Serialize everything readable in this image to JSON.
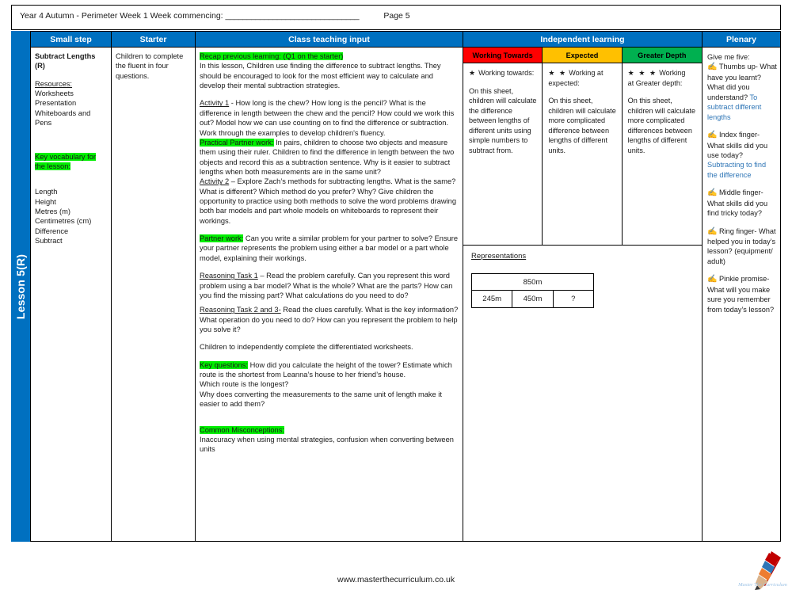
{
  "header": {
    "title": "Year 4 Autumn - Perimeter Week 1 Week commencing:",
    "blank_line": "_______________________________",
    "page_label": "Page 5"
  },
  "lesson_tab": {
    "label": "Lesson 5(R)"
  },
  "colors": {
    "header_blue": "#0070C0",
    "working_towards": "#FF0000",
    "expected": "#FFC000",
    "greater_depth": "#00B050",
    "highlight_green": "#00EE00",
    "answer_blue": "#2E75B6"
  },
  "columns": {
    "small_step": "Small step",
    "starter": "Starter",
    "class_teaching_input": "Class teaching input",
    "independent_learning": "Independent learning",
    "plenary": "Plenary"
  },
  "small_step": {
    "title": "Subtract Lengths (R)",
    "resources_label": "Resources:",
    "resources": [
      "Worksheets",
      "Presentation",
      "Whiteboards and Pens"
    ],
    "key_vocab_label": "Key vocabulary for the lesson:",
    "vocabulary": [
      "Length",
      "Height",
      "Metres (m)",
      "Centimetres (cm)",
      "Difference",
      "Subtract"
    ]
  },
  "starter": {
    "text": "Children to complete the fluent in four questions."
  },
  "teaching": {
    "recap_label": "Recap previous learning: (Q1 on the starter)",
    "recap_text": "In this lesson, Children use finding the difference to subtract lengths. They should be encouraged to look for the most efficient way  to calculate and develop their mental subtraction strategies.",
    "activity1_label": "Activity 1",
    "activity1_text": " -  How long is the chew?  How long is the pencil? What is the difference in length between the chew and the pencil? How could we work this out?   Model how we can use counting on to find the difference or subtraction.  Work through the examples to develop children's fluency.",
    "practical_label": "Practical Partner work:",
    "practical_text": " In pairs, children to choose two objects and  measure them using their ruler.  Children to find the difference in length between the two objects and record this as a subtraction sentence.  Why is it easier to subtract lengths when both measurements are in the same unit?",
    "activity2_label": "Activity 2",
    "activity2_text": " – Explore Zach’s methods for subtracting lengths.  What is the same? What is different?  Which method do you prefer? Why?   Give children the opportunity to practice using both methods to solve the word problems drawing both bar models and part whole models on whiteboards to represent their workings.",
    "partner_label": "Partner work:",
    "partner_text": " Can you write a similar problem for your partner to solve?  Ensure your partner represents the problem using either a bar model or a part whole model, explaining their workings.",
    "reasoning1_label": "Reasoning Task 1",
    "reasoning1_text": " – Read the problem carefully.  Can you represent this word problem using a bar model?  What is the whole?  What   are the parts?  How can you find the missing part?  What calculations do you need to do?",
    "reasoning23_label": "Reasoning Task 2 and 3-",
    "reasoning23_text": " Read the clues carefully.  What is the key information?  What operation do you need to do?  How can you represent the problem to help you solve it?",
    "independent_text": "Children to independently complete the differentiated worksheets.",
    "key_questions_label": "Key questions:",
    "key_questions_text": " How did you calculate the height of the tower? Estimate which route is the shortest from Leanna’s house to her friend’s house.",
    "key_questions_extra": [
      "Which route is the longest?",
      "Why does converting the measurements to the same unit of length make it easier to add them?"
    ],
    "misconceptions_label": "Common Misconceptions:",
    "misconceptions_text": " Inaccuracy when using mental strategies, confusion when converting between units"
  },
  "independent": {
    "levels": [
      {
        "heading": "Working Towards",
        "stars": "★",
        "subtitle": "  Working towards:",
        "body": "On this sheet, children will calculate  the difference between lengths  of different units using simple numbers to subtract\n from."
      },
      {
        "heading": "Expected",
        "stars": "★ ★",
        "subtitle": "  Working at expected:",
        "body": "On this sheet, children will calculate more complicated difference between lengths of different units."
      },
      {
        "heading": "Greater Depth",
        "stars": "★ ★ ★",
        "subtitle": " Working\nat Greater depth:",
        "body": "On this sheet, children will calculate more complicated  differences between lengths of different units."
      }
    ],
    "representations_label": "Representations",
    "bar_model": {
      "whole": "850m",
      "parts": [
        "245m",
        "450m",
        "?"
      ]
    }
  },
  "plenary": {
    "intro": "Give me five:",
    "items": [
      {
        "icon": "hand-icon",
        "prompt": " Thumbs up- What have you learnt? What did you understand?",
        "answer": "To subtract different lengths"
      },
      {
        "icon": "hand-icon",
        "prompt": " Index finger- What skills did you use today?",
        "answer": "Subtracting to find the difference"
      },
      {
        "icon": "hand-icon",
        "prompt": " Middle finger- What skills did you find tricky today?",
        "answer": ""
      },
      {
        "icon": "hand-icon",
        "prompt": " Ring finger- What helped you in today’s lesson? (equipment/ adult)",
        "answer": ""
      },
      {
        "icon": "hand-icon",
        "prompt": " Pinkie promise- What will you make sure you remember from today’s lesson?",
        "answer": ""
      }
    ]
  },
  "footer": {
    "url": "www.masterthecurriculum.co.uk",
    "logo_text": "Master The Curriculum"
  }
}
